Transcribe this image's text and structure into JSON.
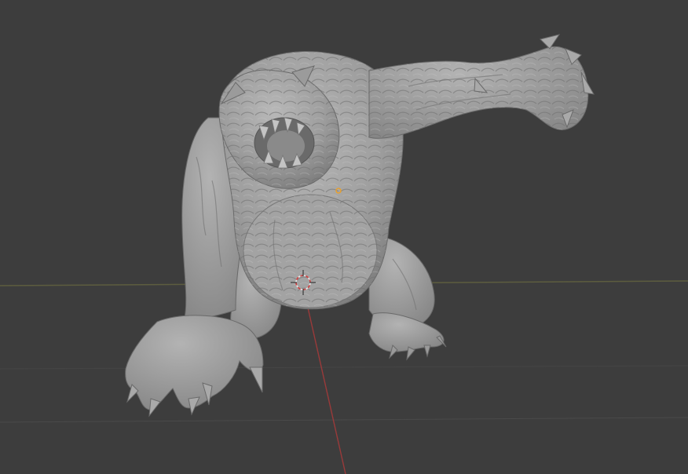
{
  "viewport": {
    "background_color": "#3d3d3d",
    "grid_line_color": "#4a4a4a",
    "x_axis_color": "#7a3a3a",
    "y_axis_color": "#6b8a3a",
    "object_color": "#a7a7a7",
    "object_shadow_color": "#7a7a7a",
    "origin_dot_color": "#f0a020",
    "cursor_color": "#d04040",
    "icons": {
      "cursor": "3d-cursor-icon",
      "origin": "object-origin-icon"
    }
  }
}
